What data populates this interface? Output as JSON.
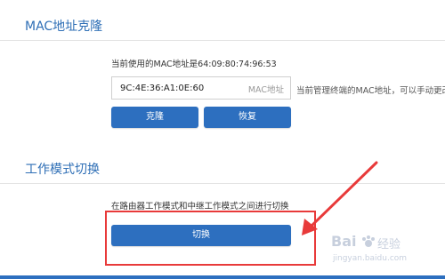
{
  "mac_section": {
    "title": "MAC地址克隆",
    "current_mac_text": "当前使用的MAC地址是64:09:80:74:96:53",
    "input_value": "9C:4E:36:A1:0E:60",
    "input_suffix": "MAC地址",
    "hint": "当前管理终端的MAC地址，可以手动更改为",
    "clone_button": "克隆",
    "restore_button": "恢复"
  },
  "mode_section": {
    "title": "工作模式切换",
    "description": "在路由器工作模式和中继工作模式之间进行切换",
    "switch_button": "切换"
  },
  "watermark": {
    "brand": "Bai",
    "brand_suffix": "经验",
    "url": "jingyan.baidu.com"
  },
  "colors": {
    "accent": "#2d6fbf",
    "title": "#2f6fb6",
    "annotation": "#e83a3a"
  }
}
